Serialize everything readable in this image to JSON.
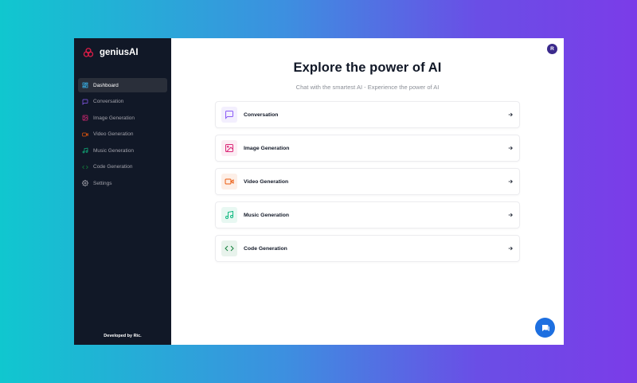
{
  "app": {
    "name": "geniusAI",
    "credit": "Developed by Ric."
  },
  "sidebar": {
    "items": [
      {
        "label": "Dashboard",
        "icon": "layout-dashboard-icon",
        "color": "#38bdf8",
        "active": true
      },
      {
        "label": "Conversation",
        "icon": "message-square-icon",
        "color": "#8b5cf6"
      },
      {
        "label": "Image Generation",
        "icon": "image-icon",
        "color": "#db2777"
      },
      {
        "label": "Video Generation",
        "icon": "video-icon",
        "color": "#ea580c"
      },
      {
        "label": "Music Generation",
        "icon": "music-icon",
        "color": "#10b981"
      },
      {
        "label": "Code Generation",
        "icon": "code-icon",
        "color": "#15803d"
      },
      {
        "label": "Settings",
        "icon": "settings-icon",
        "color": "#a1a1aa"
      }
    ]
  },
  "header": {
    "avatar_initial": "R"
  },
  "hero": {
    "title": "Explore the power of AI",
    "subtitle": "Chat with the smartest AI - Experience the power of AI"
  },
  "tools": [
    {
      "label": "Conversation",
      "icon": "message-square-icon",
      "color": "#8b5cf6",
      "bg": "#f3effe"
    },
    {
      "label": "Image Generation",
      "icon": "image-icon",
      "color": "#db2777",
      "bg": "#fcedf4"
    },
    {
      "label": "Video Generation",
      "icon": "video-icon",
      "color": "#ea580c",
      "bg": "#fdefe7"
    },
    {
      "label": "Music Generation",
      "icon": "music-icon",
      "color": "#10b981",
      "bg": "#e8f8f2"
    },
    {
      "label": "Code Generation",
      "icon": "code-icon",
      "color": "#15803d",
      "bg": "#e8f3ec"
    }
  ],
  "chat_widget": {
    "icon": "chat-bubble-icon",
    "color": "#1d6fe0"
  }
}
